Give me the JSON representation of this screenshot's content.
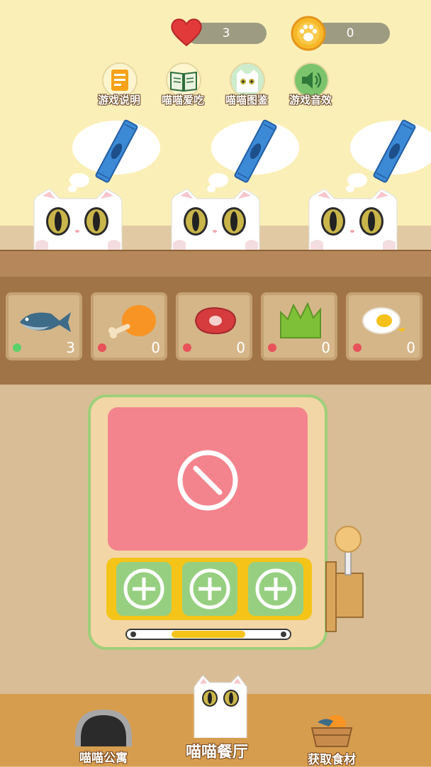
{
  "hud": {
    "hearts": "3",
    "coins": "0"
  },
  "menu": [
    {
      "label": "游戏说明",
      "icon": "instructions-icon"
    },
    {
      "label": "喵喵爱吃",
      "icon": "book-icon"
    },
    {
      "label": "喵喵图鉴",
      "icon": "cat-album-icon"
    },
    {
      "label": "游戏音效",
      "icon": "speaker-icon"
    }
  ],
  "orders": [
    {
      "item": "cat-treat-stick"
    },
    {
      "item": "cat-treat-stick"
    },
    {
      "item": "cat-treat-stick"
    }
  ],
  "ingredients": [
    {
      "name": "fish",
      "count": "3",
      "status_color": "#5cd16a"
    },
    {
      "name": "chicken-leg",
      "count": "0",
      "status_color": "#e8525a"
    },
    {
      "name": "steak",
      "count": "0",
      "status_color": "#e8525a"
    },
    {
      "name": "greens",
      "count": "0",
      "status_color": "#e8525a"
    },
    {
      "name": "fried-egg",
      "count": "0",
      "status_color": "#e8525a"
    }
  ],
  "machine": {
    "screen_icon": "prohibited-icon",
    "reels": [
      "add",
      "add",
      "add"
    ]
  },
  "nav": {
    "apartment": "喵喵公寓",
    "restaurant": "喵喵餐厅",
    "ingredients": "获取食材"
  },
  "colors": {
    "wall": "#fbefb8",
    "screen": "#f3848d",
    "reel": "#97cf81",
    "accent_yellow": "#f5c418"
  }
}
